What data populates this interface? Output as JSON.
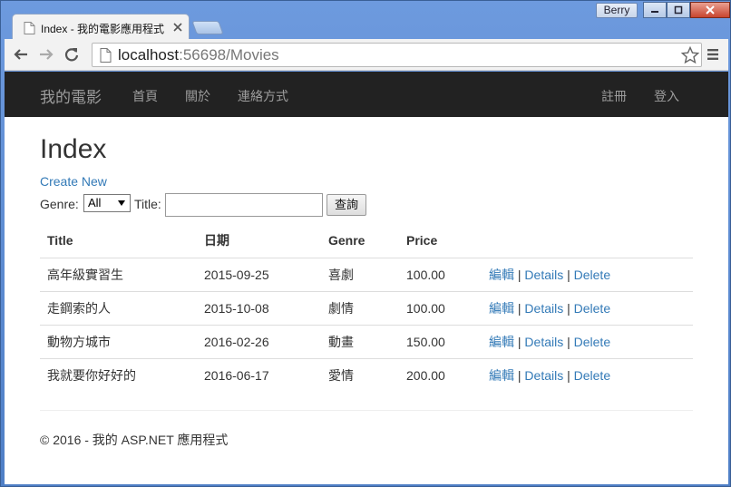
{
  "window": {
    "user": "Berry",
    "tab_title": "Index - 我的電影應用程式",
    "url_host": "localhost",
    "url_rest": ":56698/Movies"
  },
  "navbar": {
    "brand": "我的電影",
    "links": [
      "首頁",
      "關於",
      "連絡方式"
    ],
    "right_links": [
      "註冊",
      "登入"
    ]
  },
  "main": {
    "heading": "Index",
    "create_new": "Create New",
    "genre_label": "Genre:",
    "genre_selected": "All",
    "title_label": "Title:",
    "title_value": "",
    "search_button": "查詢"
  },
  "table": {
    "headers": [
      "Title",
      "日期",
      "Genre",
      "Price"
    ],
    "rows": [
      {
        "title": "高年級實習生",
        "date": "2015-09-25",
        "genre": "喜劇",
        "price": "100.00"
      },
      {
        "title": "走鋼索的人",
        "date": "2015-10-08",
        "genre": "劇情",
        "price": "100.00"
      },
      {
        "title": "動物方城市",
        "date": "2016-02-26",
        "genre": "動畫",
        "price": "150.00"
      },
      {
        "title": "我就要你好好的",
        "date": "2016-06-17",
        "genre": "愛情",
        "price": "200.00"
      }
    ],
    "actions": {
      "edit": "編輯",
      "details": "Details",
      "delete": "Delete",
      "separator": "|"
    }
  },
  "footer": {
    "text": "© 2016 - 我的 ASP.NET 應用程式"
  },
  "colors": {
    "navbar_bg": "#222222",
    "link": "#337ab7",
    "nav_text": "#9d9d9d"
  }
}
